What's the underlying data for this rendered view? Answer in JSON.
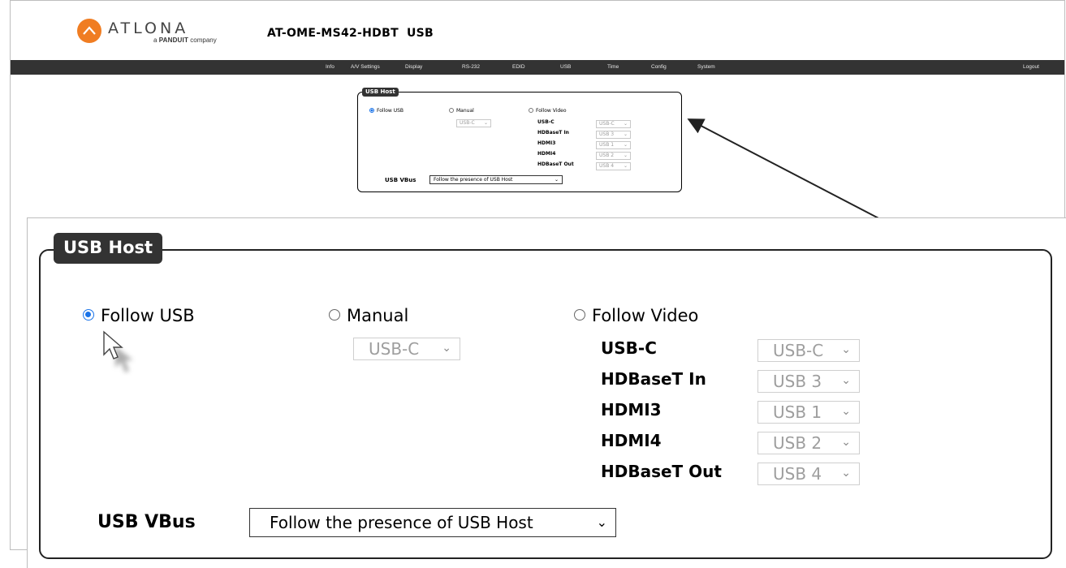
{
  "header": {
    "logo_text": "ATLONA",
    "logo_sub_prefix": "a",
    "logo_sub_brand": "PANDUIT",
    "logo_sub_suffix": "company",
    "model": "AT-OME-MS42-HDBT",
    "page": "USB"
  },
  "nav": {
    "items": [
      "Info",
      "A/V Settings",
      "Display",
      "RS-232",
      "EDID",
      "USB",
      "Time",
      "Config",
      "System"
    ],
    "logout": "Logout"
  },
  "usb_host": {
    "title": "USB Host",
    "modes": [
      {
        "label": "Follow USB",
        "selected": true
      },
      {
        "label": "Manual",
        "selected": false
      },
      {
        "label": "Follow Video",
        "selected": false
      }
    ],
    "manual_select": "USB-C",
    "follow_video_rows": [
      {
        "label": "USB-C",
        "value": "USB-C"
      },
      {
        "label": "HDBaseT In",
        "value": "USB 3"
      },
      {
        "label": "HDMI3",
        "value": "USB 1"
      },
      {
        "label": "HDMI4",
        "value": "USB 2"
      },
      {
        "label": "HDBaseT Out",
        "value": "USB 4"
      }
    ],
    "vbus_label": "USB VBus",
    "vbus_value": "Follow the presence of USB Host"
  },
  "icons": {
    "chevron": "chevron-down-icon",
    "cursor": "mouse-pointer-icon",
    "callout": "callout-arrow-icon"
  },
  "colors": {
    "navbar": "#333333",
    "logo": "#f07d22",
    "radio_selected": "#1a73e8",
    "disabled_text": "#9e9e9e"
  }
}
